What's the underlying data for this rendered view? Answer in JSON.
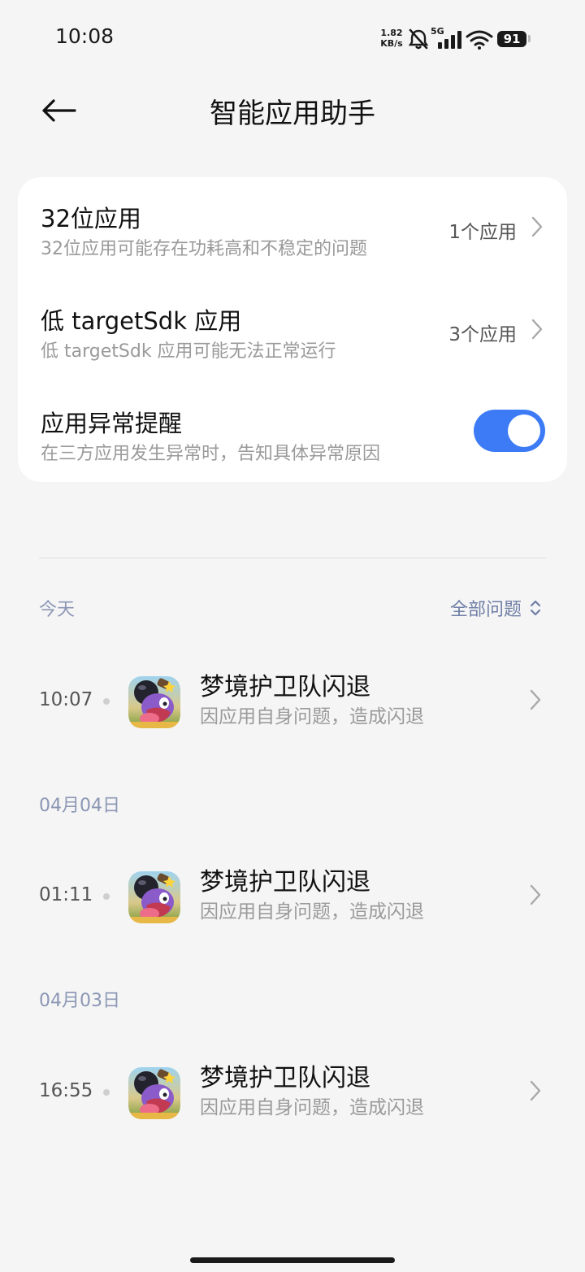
{
  "status_bar": {
    "time": "10:08",
    "net_speed_value": "1.82",
    "net_speed_unit": "KB/s",
    "signal_tag": "5G",
    "battery": "91"
  },
  "header": {
    "title": "智能应用助手",
    "back_icon": "arrow-left-icon"
  },
  "settings": {
    "rows": [
      {
        "title": "32位应用",
        "subtitle": "32位应用可能存在功耗高和不稳定的问题",
        "value": "1个应用"
      },
      {
        "title": "低 targetSdk 应用",
        "subtitle": "低 targetSdk 应用可能无法正常运行",
        "value": "3个应用"
      },
      {
        "title": "应用异常提醒",
        "subtitle": "在三方应用发生异常时，告知具体异常原因",
        "toggle_on": true
      }
    ]
  },
  "colors": {
    "accent": "#3c7bf5",
    "background": "#f5f5f5",
    "date_label": "#8c97b5"
  },
  "log": {
    "filter_label": "全部问题",
    "groups": [
      {
        "date": "今天",
        "entries": [
          {
            "time": "10:07",
            "app": "梦境护卫队闪退",
            "reason": "因应用自身问题，造成闪退"
          }
        ]
      },
      {
        "date": "04月04日",
        "entries": [
          {
            "time": "01:11",
            "app": "梦境护卫队闪退",
            "reason": "因应用自身问题，造成闪退"
          }
        ]
      },
      {
        "date": "04月03日",
        "entries": [
          {
            "time": "16:55",
            "app": "梦境护卫队闪退",
            "reason": "因应用自身问题，造成闪退"
          }
        ]
      }
    ]
  }
}
